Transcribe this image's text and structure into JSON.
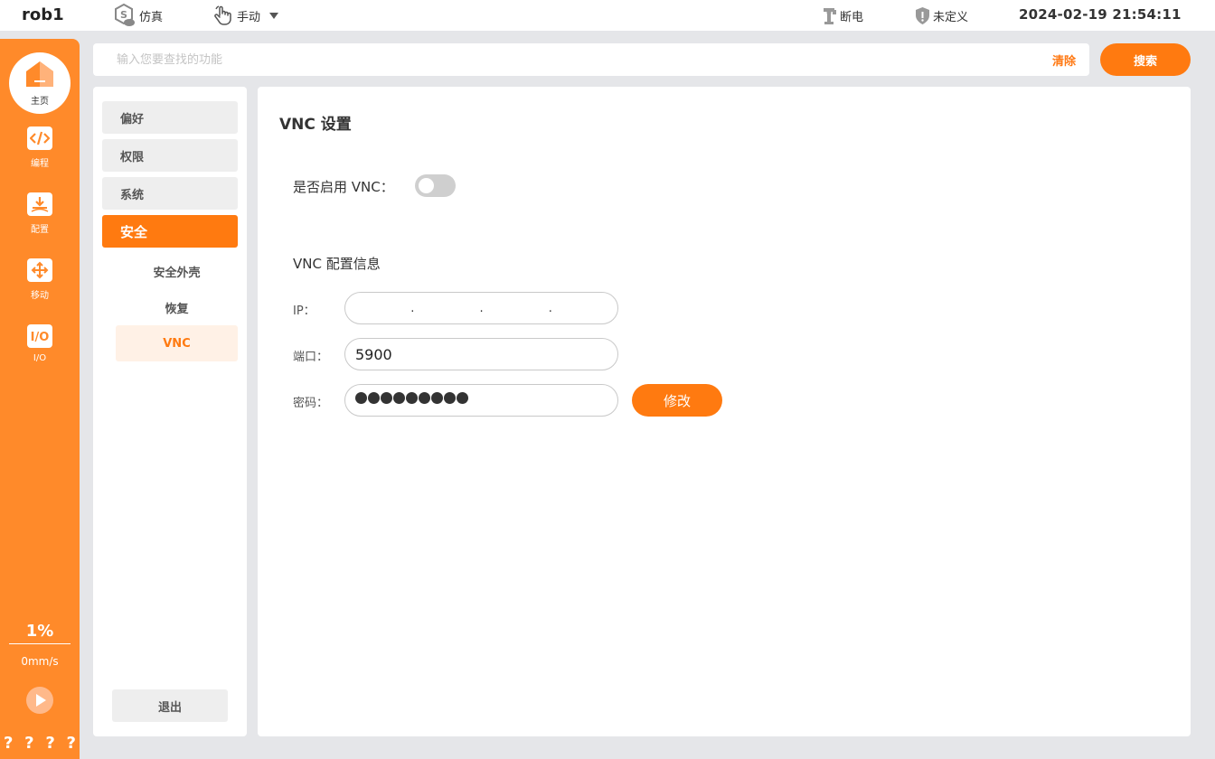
{
  "topbar": {
    "robot_name": "rob1",
    "sim_label": "仿真",
    "sim_icon": "simulation-s-icon",
    "mode_label": "手动",
    "mode_icon": "hand-pointer-icon",
    "power_label": "断电",
    "power_icon": "robot-arm-icon",
    "safety_label": "未定义",
    "safety_icon": "shield-icon",
    "datetime": "2024-02-19 21:54:11"
  },
  "leftnav": {
    "items": [
      {
        "label": "主页",
        "icon": "home-icon"
      },
      {
        "label": "编程",
        "icon": "code-icon"
      },
      {
        "label": "配置",
        "icon": "config-download-icon"
      },
      {
        "label": "移动",
        "icon": "move-arrows-icon"
      },
      {
        "label": "I/O",
        "icon": "io-icon"
      }
    ],
    "speed_percent": "1%",
    "speed_value": "0mm/s",
    "status_marks": [
      "?",
      "?",
      "?",
      "?"
    ]
  },
  "search": {
    "placeholder": "输入您要查找的功能",
    "value": "",
    "clear_label": "清除",
    "button_label": "搜索"
  },
  "menu": {
    "items": [
      {
        "label": "偏好"
      },
      {
        "label": "权限"
      },
      {
        "label": "系统"
      },
      {
        "label": "安全"
      }
    ],
    "active": "安全",
    "sub_items": [
      {
        "label": "安全外壳"
      },
      {
        "label": "恢复"
      },
      {
        "label": "VNC"
      }
    ],
    "active_sub": "VNC",
    "exit_label": "退出"
  },
  "vnc": {
    "title": "VNC 设置",
    "enable_label": "是否启用 VNC：",
    "enabled": false,
    "config_title": "VNC 配置信息",
    "ip_label": "IP：",
    "ip_segments": [
      "",
      "",
      "",
      ""
    ],
    "port_label": "端口：",
    "port_value": "5900",
    "password_label": "密码：",
    "password_dot_count": 9,
    "modify_label": "修改"
  },
  "colors": {
    "accent": "#ff7a10",
    "nav_bg": "#ff8a2a",
    "page_bg": "#e5e6e9"
  }
}
